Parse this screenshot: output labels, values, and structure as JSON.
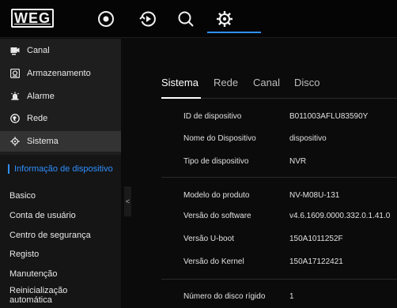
{
  "header": {
    "logo_text": "WEG",
    "icons": [
      "live-view-icon",
      "playback-icon",
      "search-icon",
      "settings-icon"
    ],
    "accent_color": "#2f8fff"
  },
  "sidebar": {
    "items": [
      {
        "label": "Canal",
        "icon": "camera-icon"
      },
      {
        "label": "Armazenamento",
        "icon": "storage-icon"
      },
      {
        "label": "Alarme",
        "icon": "alarm-icon"
      },
      {
        "label": "Rede",
        "icon": "network-icon"
      },
      {
        "label": "Sistema",
        "icon": "gear-icon"
      }
    ],
    "submenu": [
      "Informação de dispositivo",
      "Basico",
      "Conta de usuário",
      "Centro de segurança",
      "Registo",
      "Manutenção",
      "Reinicialização automática"
    ],
    "collapse_glyph": "<"
  },
  "main": {
    "tabs": [
      "Sistema",
      "Rede",
      "Canal",
      "Disco"
    ],
    "rows": [
      {
        "label": "ID de dispositivo",
        "value": "B011003AFLU83590Y"
      },
      {
        "label": "Nome do Dispositivo",
        "value": "dispositivo"
      },
      {
        "label": "Tipo de dispositivo",
        "value": "NVR"
      },
      {
        "label": "Modelo do produto",
        "value": "NV-M08U-131"
      },
      {
        "label": "Versão do software",
        "value": "v4.6.1609.0000.332.0.1.41.0"
      },
      {
        "label": "Versão U-boot",
        "value": "150A1011252F"
      },
      {
        "label": "Versão do Kernel",
        "value": "150A17122421"
      },
      {
        "label": "Número do disco rígido",
        "value": "1"
      }
    ]
  }
}
